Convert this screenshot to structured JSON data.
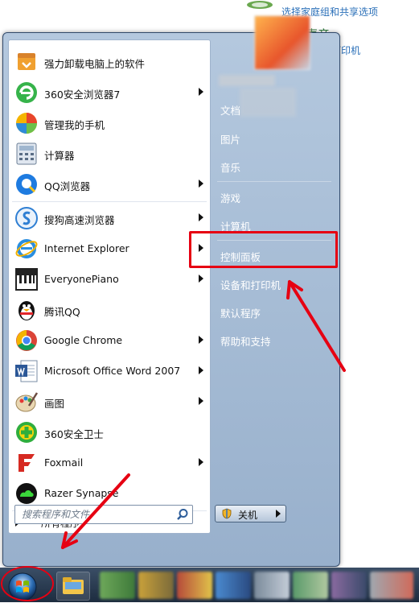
{
  "background": {
    "link_top": "选择家庭组和共享选项",
    "title": "声音",
    "link_second": "打印机"
  },
  "programs": [
    {
      "label": "强力卸载电脑上的软件",
      "icon": "uninstaller-icon",
      "has_submenu": false
    },
    {
      "label": "360安全浏览器7",
      "icon": "360-browser-icon",
      "has_submenu": true
    },
    {
      "label": "管理我的手机",
      "icon": "phone-manager-icon",
      "has_submenu": false
    },
    {
      "label": "计算器",
      "icon": "calculator-icon",
      "has_submenu": false
    },
    {
      "label": "QQ浏览器",
      "icon": "qq-browser-icon",
      "has_submenu": true
    },
    {
      "label": "搜狗高速浏览器",
      "icon": "sogou-browser-icon",
      "has_submenu": true
    },
    {
      "label": "Internet Explorer",
      "icon": "internet-explorer-icon",
      "has_submenu": true
    },
    {
      "label": "EveryonePiano",
      "icon": "piano-icon",
      "has_submenu": true
    },
    {
      "label": "腾讯QQ",
      "icon": "qq-penguin-icon",
      "has_submenu": false
    },
    {
      "label": "Google Chrome",
      "icon": "chrome-icon",
      "has_submenu": true
    },
    {
      "label": "Microsoft Office Word 2007",
      "icon": "word-icon",
      "has_submenu": true
    },
    {
      "label": "画图",
      "icon": "paint-icon",
      "has_submenu": true
    },
    {
      "label": "360安全卫士",
      "icon": "360-safeguard-icon",
      "has_submenu": false
    },
    {
      "label": "Foxmail",
      "icon": "foxmail-icon",
      "has_submenu": true
    },
    {
      "label": "Razer Synapse",
      "icon": "razer-icon",
      "has_submenu": false
    }
  ],
  "all_programs_label": "所有程序",
  "search": {
    "placeholder": "搜索程序和文件"
  },
  "right_items": [
    {
      "label": "文档"
    },
    {
      "label": "图片"
    },
    {
      "label": "音乐"
    },
    {
      "label": "游戏"
    },
    {
      "label": "计算机"
    },
    {
      "label": "控制面板"
    },
    {
      "label": "设备和打印机"
    },
    {
      "label": "默认程序"
    },
    {
      "label": "帮助和支持"
    }
  ],
  "shutdown_label": "关机",
  "colors": {
    "annotation_red": "#e60012",
    "menu_right_bg": "#98b0cc",
    "taskbar": "#1d2c3f"
  }
}
